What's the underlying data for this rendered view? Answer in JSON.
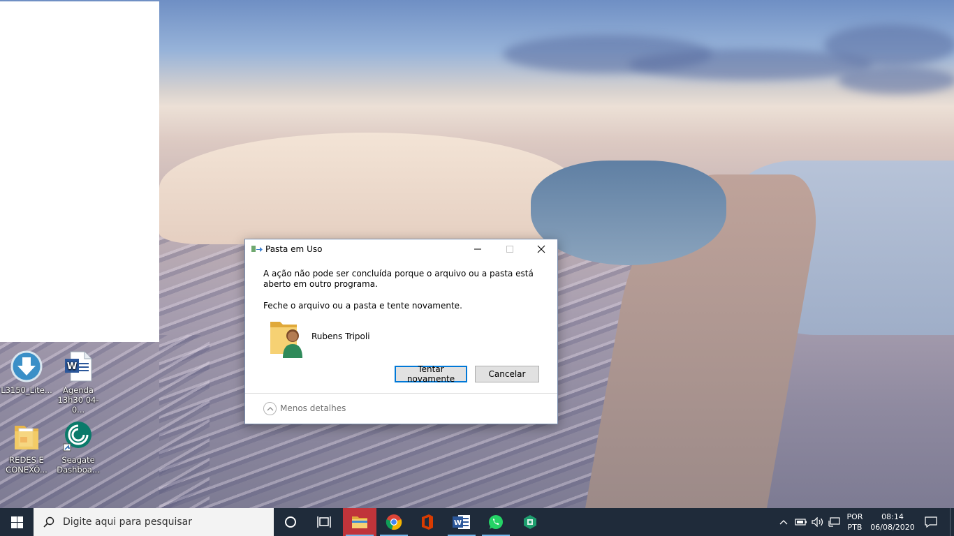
{
  "desktop": {
    "icons": [
      {
        "label_line1": "L3150_Lite...",
        "label_line2": "",
        "icon": "download-arrow-icon"
      },
      {
        "label_line1": "Agenda",
        "label_line2": "13h30 04-0...",
        "icon": "word-document-icon"
      },
      {
        "label_line1": "REDES E",
        "label_line2": "CONEXÕ...",
        "icon": "pdf-folder-icon"
      },
      {
        "label_line1": "Seagate",
        "label_line2": "Dashboa...",
        "icon": "seagate-icon"
      }
    ]
  },
  "dialog": {
    "title": "Pasta em Uso",
    "message_line": "A ação não pode ser concluída porque o arquivo ou a pasta está aberto em outro programa.",
    "instruction": "Feche o arquivo ou a pasta e tente novamente.",
    "item_name": "Rubens Tripoli",
    "retry_label": "Tentar novamente",
    "cancel_label": "Cancelar",
    "less_details": "Menos detalhes",
    "minimize_glyph": "—",
    "maximize_glyph": "☐",
    "close_glyph": "✕"
  },
  "taskbar": {
    "search_placeholder": "Digite aqui para pesquisar",
    "apps": [
      "task-view",
      "file-explorer",
      "chrome",
      "office",
      "word",
      "whatsapp",
      "app-green"
    ],
    "language_line1": "POR",
    "language_line2": "PTB",
    "time": "08:14",
    "date": "06/08/2020"
  },
  "colors": {
    "taskbar_bg": "#1f2b3a",
    "explorer_active": "#c0343a",
    "button_focus": "#0078d7"
  }
}
